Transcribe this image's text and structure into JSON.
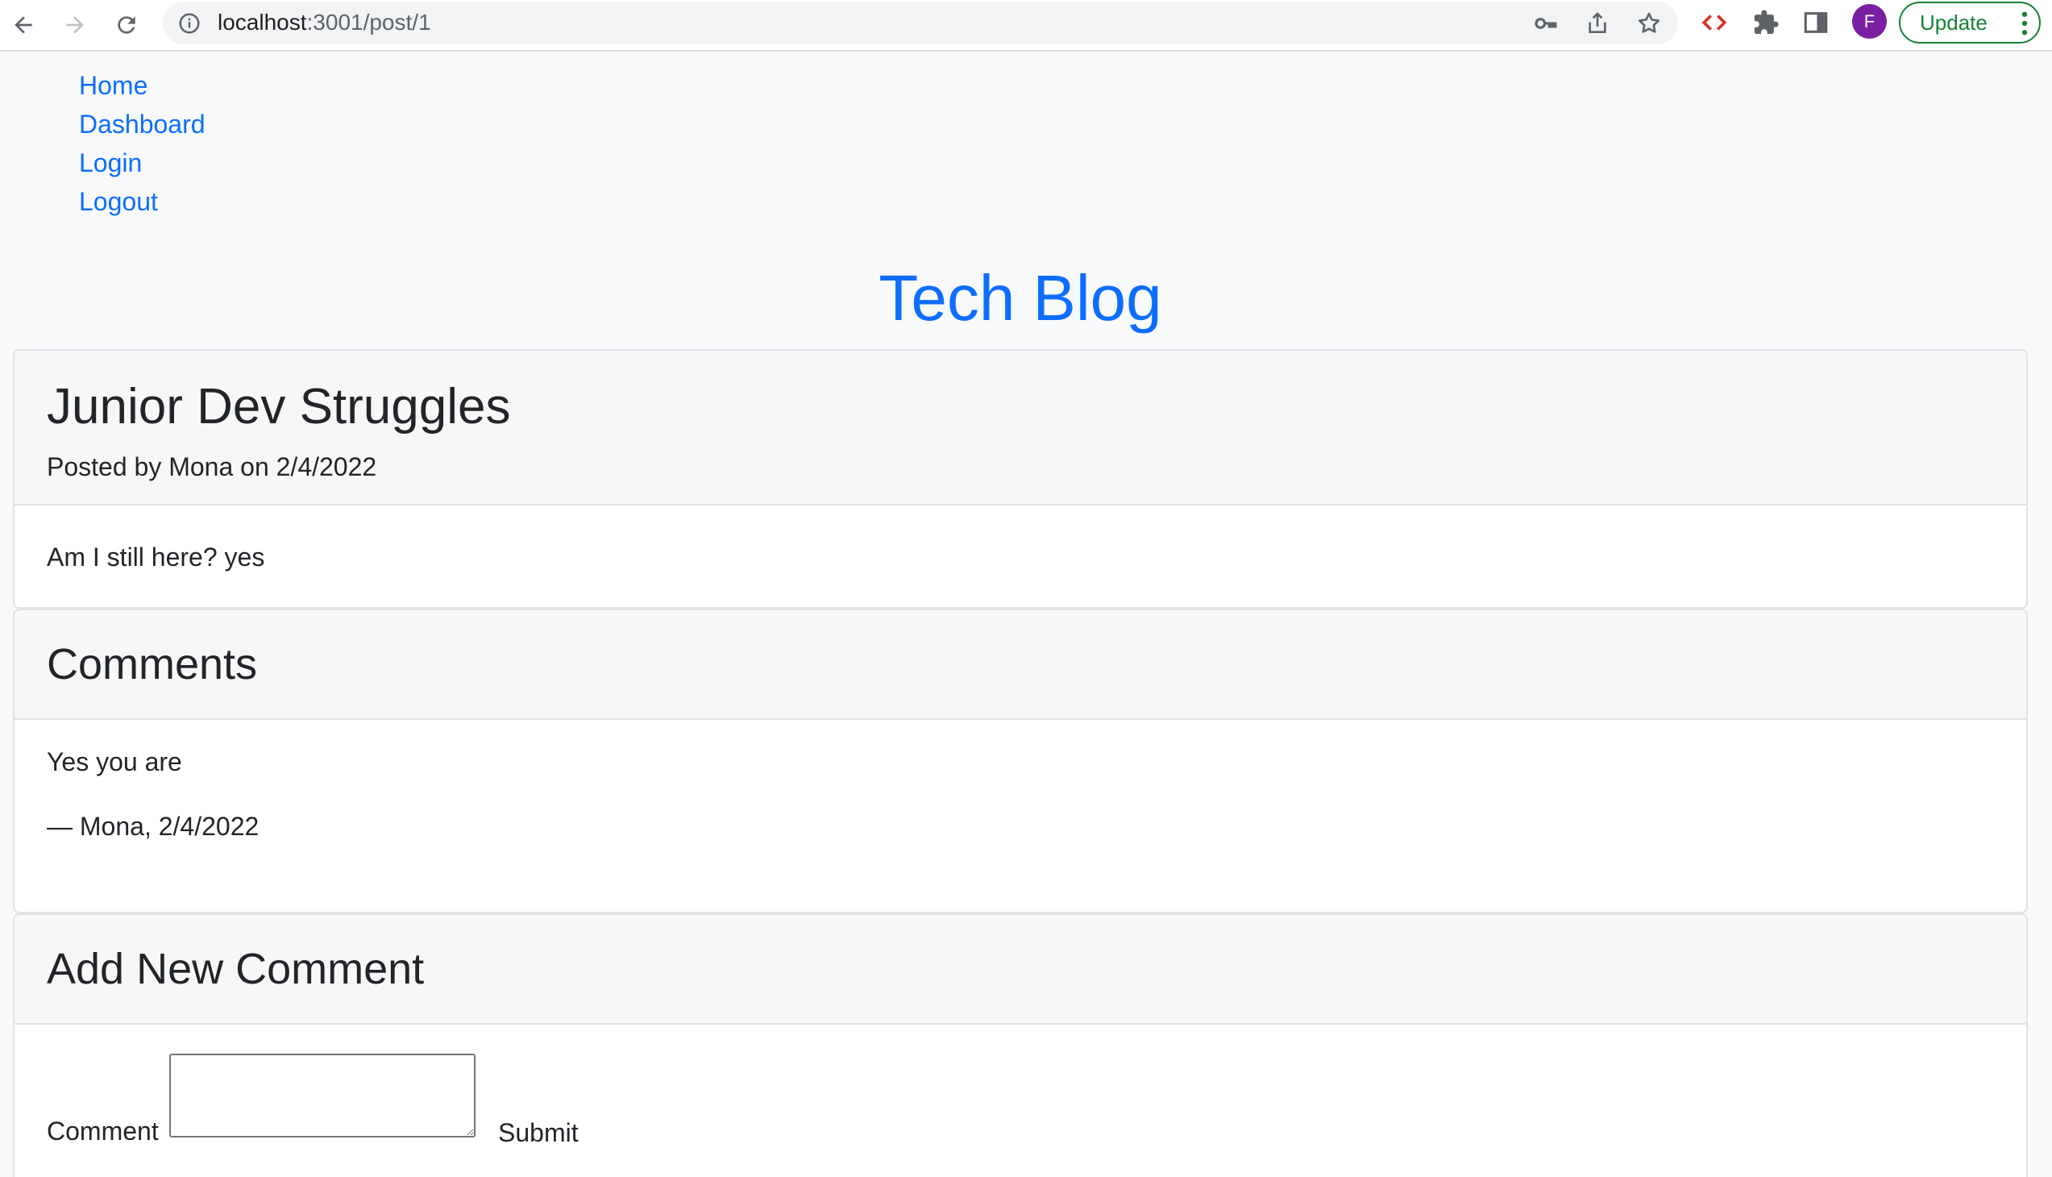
{
  "browser": {
    "url_host": "localhost",
    "url_path": ":3001/post/1",
    "profile_initial": "F",
    "update_label": "Update",
    "icons": [
      "back-icon",
      "forward-icon",
      "reload-icon",
      "info-icon",
      "key-icon",
      "share-icon",
      "star-icon",
      "devtools-icon",
      "extensions-icon",
      "sidepanel-icon",
      "menu-dots-icon"
    ],
    "colors": {
      "update": "#188038",
      "avatar": "#7b1fa2",
      "devtools_red": "#d93025",
      "devtools_blue": "#1a73e8"
    }
  },
  "nav": {
    "items": [
      {
        "label": "Home"
      },
      {
        "label": "Dashboard"
      },
      {
        "label": "Login"
      },
      {
        "label": "Logout"
      }
    ]
  },
  "site": {
    "title": "Tech Blog",
    "accent": "#0d6efd"
  },
  "post": {
    "title": "Junior Dev Struggles",
    "byline": "Posted by Mona on 2/4/2022",
    "content": "Am I still here? yes"
  },
  "comments": {
    "heading": "Comments",
    "items": [
      {
        "text": "Yes you are",
        "meta": "— Mona, 2/4/2022"
      }
    ]
  },
  "new_comment": {
    "heading": "Add New Comment",
    "label": "Comment",
    "value": "",
    "submit_label": "Submit"
  }
}
